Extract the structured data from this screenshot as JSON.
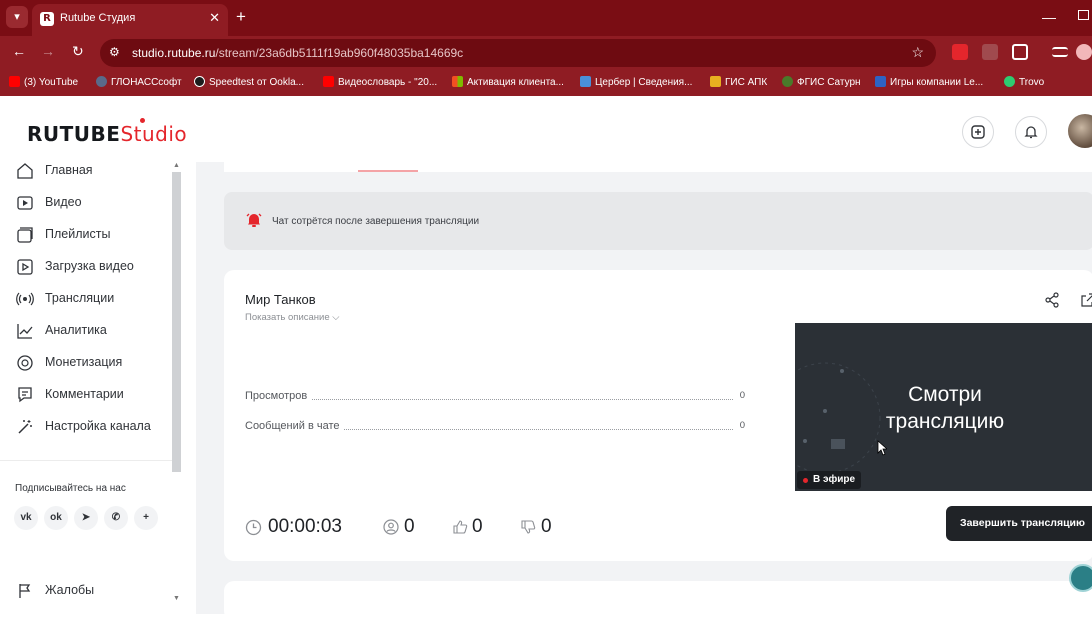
{
  "browser": {
    "tab_title": "Rutube Студия",
    "tab_favicon_letter": "R",
    "url_domain": "studio.rutube.ru",
    "url_path": "/stream/23a6db5111f19ab960f48035ba14669c",
    "bookmarks": [
      {
        "label": "(3) YouTube",
        "color": "#ff0000"
      },
      {
        "label": "ГЛОНАССсофт",
        "color": "#5a6a8a"
      },
      {
        "label": "Speedtest от Ookla...",
        "color": "#1c1c1c"
      },
      {
        "label": "Видеословарь - \"20...",
        "color": "#ff0000"
      },
      {
        "label": "Активация клиента...",
        "color": "#f25022"
      },
      {
        "label": "Цербер | Сведения...",
        "color": "#4a90d9"
      },
      {
        "label": "ГИС АПК",
        "color": "#e8b020"
      },
      {
        "label": "ФГИС Сатурн",
        "color": "#4a7a2a"
      },
      {
        "label": "Игры компании Le...",
        "color": "#2e63c4"
      },
      {
        "label": "Trovo",
        "color": "#2ecc71"
      }
    ]
  },
  "header": {
    "logo_main": "RUTUBE",
    "logo_studio": "Studio"
  },
  "sidebar": {
    "items": [
      {
        "label": "Главная",
        "icon": "home-icon"
      },
      {
        "label": "Видео",
        "icon": "video-icon"
      },
      {
        "label": "Плейлисты",
        "icon": "playlist-icon"
      },
      {
        "label": "Загрузка видео",
        "icon": "upload-icon"
      },
      {
        "label": "Трансляции",
        "icon": "broadcast-icon"
      },
      {
        "label": "Аналитика",
        "icon": "analytics-icon"
      },
      {
        "label": "Монетизация",
        "icon": "monetization-icon"
      },
      {
        "label": "Комментарии",
        "icon": "comments-icon"
      },
      {
        "label": "Настройка канала",
        "icon": "wand-icon"
      }
    ],
    "subscribe_title": "Подписывайтесь на нас",
    "social": [
      "vk",
      "ok",
      "telegram",
      "viber",
      "more"
    ],
    "complaints_label": "Жалобы"
  },
  "notice": {
    "text": "Чат сотрётся после завершения трансляции"
  },
  "stream": {
    "title": "Мир Танков",
    "show_description": "Показать описание",
    "stats": [
      {
        "label": "Просмотров",
        "value": "0"
      },
      {
        "label": "Сообщений в чате",
        "value": "0"
      }
    ],
    "preview_text_line1": "Смотри",
    "preview_text_line2": "трансляцию",
    "live_badge": "В эфире",
    "timer": "00:00:03",
    "viewers": "0",
    "likes": "0",
    "dislikes": "0",
    "end_button": "Завершить трансляцию"
  },
  "colors": {
    "brand_red": "#e4262c",
    "browser_dark_red": "#7a0d14",
    "dark_button": "#202327"
  }
}
